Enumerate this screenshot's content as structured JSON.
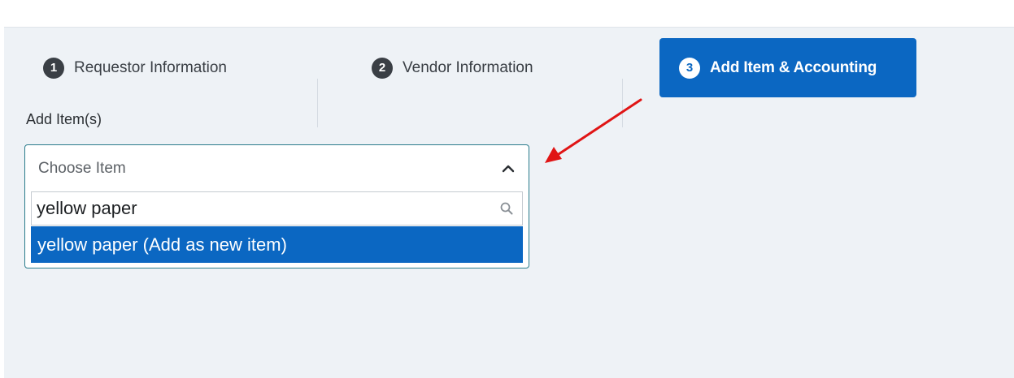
{
  "steps": [
    {
      "number": "1",
      "label": "Requestor Information",
      "active": false
    },
    {
      "number": "2",
      "label": "Vendor Information",
      "active": false
    },
    {
      "number": "3",
      "label": "Add Item & Accounting",
      "active": true
    }
  ],
  "add_items": {
    "label": "Add Item(s)",
    "select": {
      "placeholder": "Choose Item",
      "icon": "chevron-up-icon"
    },
    "search": {
      "value": "yellow paper",
      "icon": "search-icon"
    },
    "options": [
      {
        "label": "yellow paper (Add as new item)",
        "highlighted": true
      }
    ]
  },
  "annotation": {
    "color": "#e01515"
  },
  "colors": {
    "accent": "#0b67c2",
    "panel_bg": "#eef2f6",
    "step_inactive": "#3a3f45"
  }
}
